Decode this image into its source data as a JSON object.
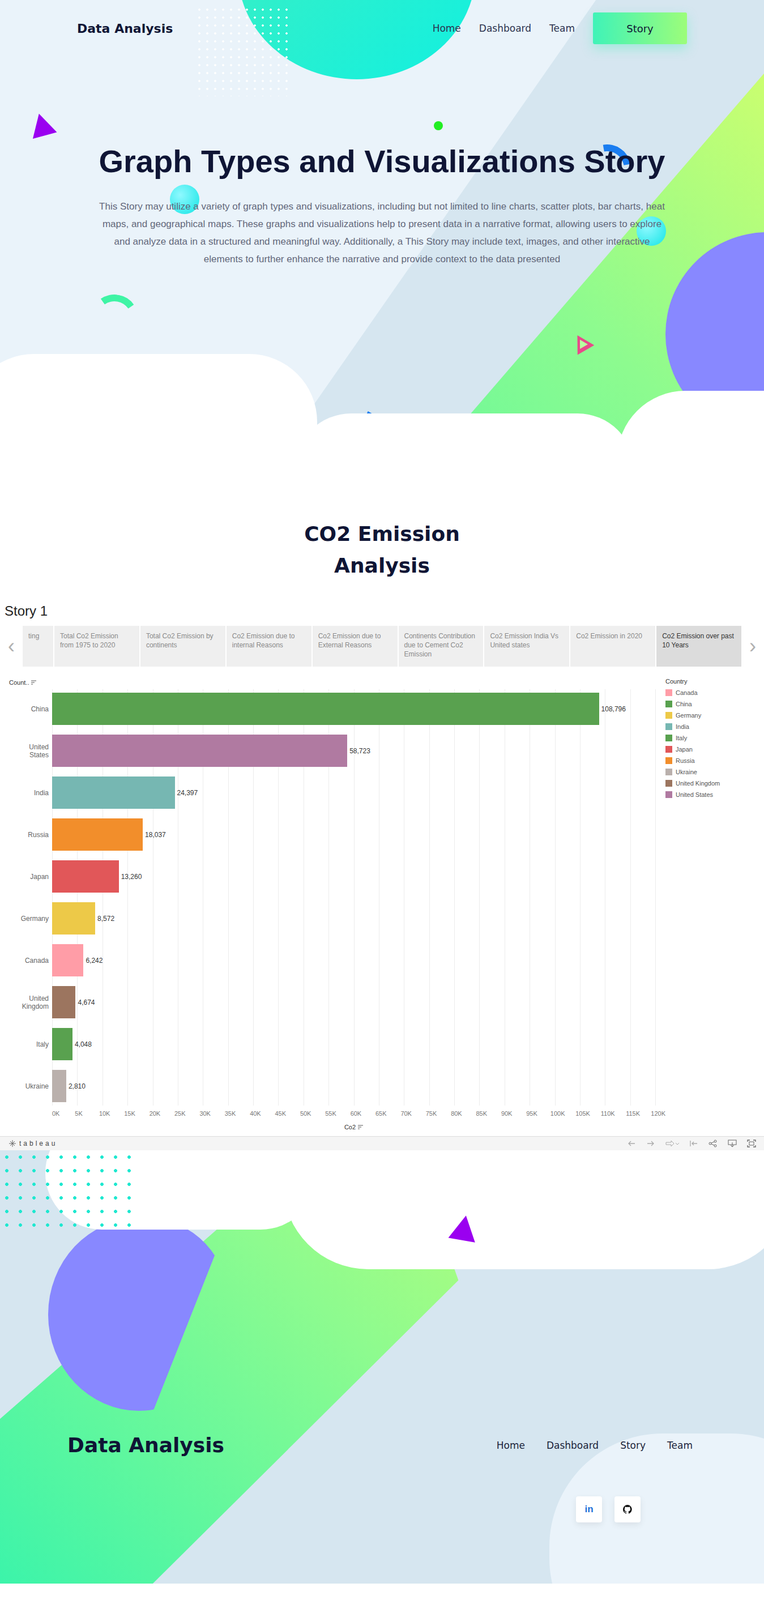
{
  "header": {
    "logo": "Data Analysis",
    "nav": [
      "Home",
      "Dashboard",
      "Team"
    ],
    "cta": "Story"
  },
  "hero": {
    "title": "Graph Types and Visualizations Story",
    "text": "This Story may utilize a variety of graph types and visualizations, including but not limited to line charts, scatter plots, bar charts, heat maps, and geographical maps. These graphs and visualizations help to present data in a narrative format, allowing users to explore and analyze data in a structured and meaningful way. Additionally, a This Story may include text, images, and other interactive elements to further enhance the narrative and provide context to the data presented"
  },
  "section": {
    "title": "CO2 Emission Analysis"
  },
  "story": {
    "title": "Story 1",
    "prev_icon": "‹",
    "next_icon": "›",
    "tabs": [
      {
        "label": "ting",
        "selected": false
      },
      {
        "label": "Total Co2 Emission from 1975 to 2020",
        "selected": false
      },
      {
        "label": "Total Co2 Emission by continents",
        "selected": false
      },
      {
        "label": "Co2 Emission due to internal Reasons",
        "selected": false
      },
      {
        "label": "Co2 Emission due to External Reasons",
        "selected": false
      },
      {
        "label": "Continents Contribution due to Cement Co2 Emission",
        "selected": false
      },
      {
        "label": "Co2 Emission India Vs United states",
        "selected": false
      },
      {
        "label": "Co2 Emission in 2020",
        "selected": false
      },
      {
        "label": "Co2 Emission over past 10 Years",
        "selected": true
      }
    ],
    "chart": {
      "y_title": "Count..",
      "x_title": "Co2",
      "bars": [
        {
          "country": "China",
          "value": 108796,
          "label": "108,796",
          "color": "#59a14f"
        },
        {
          "country": "United States",
          "value": 58723,
          "label": "58,723",
          "color": "#b07aa1"
        },
        {
          "country": "India",
          "value": 24397,
          "label": "24,397",
          "color": "#76b7b2"
        },
        {
          "country": "Russia",
          "value": 18037,
          "label": "18,037",
          "color": "#f28e2b"
        },
        {
          "country": "Japan",
          "value": 13260,
          "label": "13,260",
          "color": "#e15759"
        },
        {
          "country": "Germany",
          "value": 8572,
          "label": "8,572",
          "color": "#edc948"
        },
        {
          "country": "Canada",
          "value": 6242,
          "label": "6,242",
          "color": "#ff9da7"
        },
        {
          "country": "United Kingdom",
          "value": 4674,
          "label": "4,674",
          "color": "#9c755f"
        },
        {
          "country": "Italy",
          "value": 4048,
          "label": "4,048",
          "color": "#59a14f"
        },
        {
          "country": "Ukraine",
          "value": 2810,
          "label": "2,810",
          "color": "#bab0ac"
        }
      ],
      "ticks": [
        {
          "label": "0K",
          "value": 0
        },
        {
          "label": "5K",
          "value": 5000
        },
        {
          "label": "10K",
          "value": 10000
        },
        {
          "label": "15K",
          "value": 15000
        },
        {
          "label": "20K",
          "value": 20000
        },
        {
          "label": "25K",
          "value": 25000
        },
        {
          "label": "30K",
          "value": 30000
        },
        {
          "label": "35K",
          "value": 35000
        },
        {
          "label": "40K",
          "value": 40000
        },
        {
          "label": "45K",
          "value": 45000
        },
        {
          "label": "50K",
          "value": 50000
        },
        {
          "label": "55K",
          "value": 55000
        },
        {
          "label": "60K",
          "value": 60000
        },
        {
          "label": "65K",
          "value": 65000
        },
        {
          "label": "70K",
          "value": 70000
        },
        {
          "label": "75K",
          "value": 75000
        },
        {
          "label": "80K",
          "value": 80000
        },
        {
          "label": "85K",
          "value": 85000
        },
        {
          "label": "90K",
          "value": 90000
        },
        {
          "label": "95K",
          "value": 95000
        },
        {
          "label": "100K",
          "value": 100000
        },
        {
          "label": "105K",
          "value": 105000
        },
        {
          "label": "110K",
          "value": 110000
        },
        {
          "label": "115K",
          "value": 115000
        },
        {
          "label": "120K",
          "value": 120000
        }
      ],
      "legend": {
        "title": "Country",
        "items": [
          {
            "label": "Canada",
            "color": "#ff9da7"
          },
          {
            "label": "China",
            "color": "#59a14f"
          },
          {
            "label": "Germany",
            "color": "#edc948"
          },
          {
            "label": "India",
            "color": "#76b7b2"
          },
          {
            "label": "Italy",
            "color": "#59a14f"
          },
          {
            "label": "Japan",
            "color": "#e15759"
          },
          {
            "label": "Russia",
            "color": "#f28e2b"
          },
          {
            "label": "Ukraine",
            "color": "#bab0ac"
          },
          {
            "label": "United Kingdom",
            "color": "#9c755f"
          },
          {
            "label": "United States",
            "color": "#b07aa1"
          }
        ]
      }
    },
    "toolbar": {
      "logo": "tableau"
    }
  },
  "footer": {
    "logo": "Data Analysis",
    "nav": [
      "Home",
      "Dashboard",
      "Story",
      "Team"
    ],
    "social": [
      {
        "kind": "linkedin",
        "label": "in"
      },
      {
        "kind": "github",
        "label": ""
      }
    ]
  }
}
